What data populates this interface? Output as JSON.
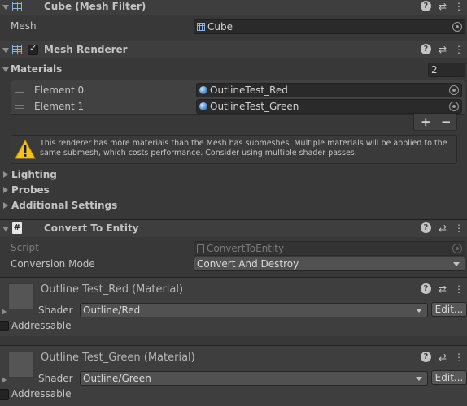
{
  "mesh_filter": {
    "title": "Cube (Mesh Filter)",
    "mesh_label": "Mesh",
    "mesh_value": "Cube"
  },
  "mesh_renderer": {
    "title": "Mesh Renderer",
    "enabled": true,
    "materials_label": "Materials",
    "materials_count": "2",
    "elements": [
      {
        "label": "Element 0",
        "value": "OutlineTest_Red"
      },
      {
        "label": "Element 1",
        "value": "OutlineTest_Green"
      }
    ],
    "add_label": "+",
    "remove_label": "−",
    "warning": "This renderer has more materials than the Mesh has submeshes. Multiple materials will be applied to the same submesh, which costs performance. Consider using multiple shader passes.",
    "sections": [
      "Lighting",
      "Probes",
      "Additional Settings"
    ]
  },
  "convert_to_entity": {
    "title": "Convert To Entity",
    "script_label": "Script",
    "script_value": "ConvertToEntity",
    "mode_label": "Conversion Mode",
    "mode_value": "Convert And Destroy"
  },
  "materials": [
    {
      "title": "Outline Test_Red (Material)",
      "shader_label": "Shader",
      "shader_value": "Outline/Red",
      "edit_label": "Edit...",
      "addressable_label": "Addressable"
    },
    {
      "title": "Outline Test_Green (Material)",
      "shader_label": "Shader",
      "shader_value": "Outline/Green",
      "edit_label": "Edit...",
      "addressable_label": "Addressable"
    }
  ],
  "header_icons": [
    "help-icon",
    "presets-icon",
    "kebab-menu-icon"
  ],
  "colors": {
    "background": "#383838",
    "header": "#3e3e3e",
    "field": "#2a2a2a",
    "warning": "#f4c21b"
  }
}
